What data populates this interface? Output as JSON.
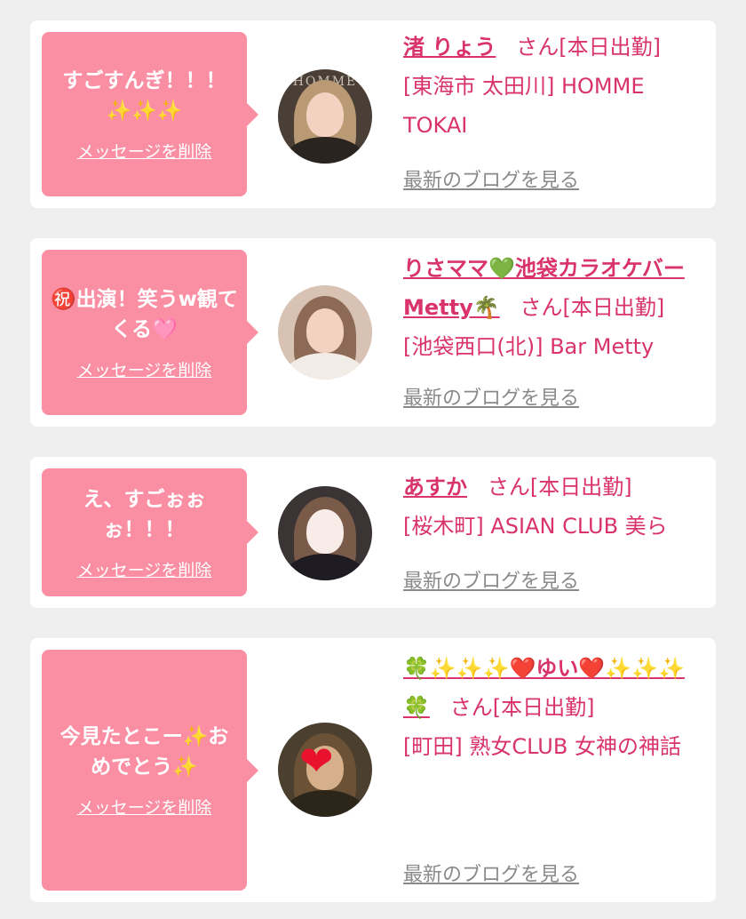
{
  "messages": [
    {
      "bubble_text": "すごすんぎ！！！✨✨✨",
      "delete_label": "メッセージを削除",
      "cast_name": "渚 りょう",
      "san_status": "さん[本日出勤]",
      "shop": "[東海市 太田川] HOMME TOKAI",
      "blog_label": "最新のブログを見る",
      "avatar_text": "HOMME"
    },
    {
      "bubble_text": "㊗️出演！笑うw観てくる🩷",
      "delete_label": "メッセージを削除",
      "cast_name": "りさママ💚池袋カラオケバーMetty🌴",
      "san_status": "さん[本日出勤]",
      "shop": "[池袋西口(北)] Bar Metty",
      "blog_label": "最新のブログを見る"
    },
    {
      "bubble_text": "え、すごぉぉぉ！！！",
      "delete_label": "メッセージを削除",
      "cast_name": "あすか",
      "san_status": "さん[本日出勤]",
      "shop": "[桜木町] ASIAN CLUB 美ら",
      "blog_label": "最新のブログを見る"
    },
    {
      "bubble_text": "今見たとこー✨おめでとう✨",
      "delete_label": "メッセージを削除",
      "cast_name": "🍀✨✨✨❤️ゆい❤️✨✨✨🍀",
      "san_status": "さん[本日出勤]",
      "shop": "[町田] 熟女CLUB 女神の神話",
      "blog_label": "最新のブログを見る",
      "avatar_overlay": "❤"
    }
  ],
  "colors": {
    "page_bg": "#f0eff0",
    "card_bg": "#ffffff",
    "bubble_bg": "#fa8fa3",
    "accent_text": "#d9336b",
    "blog_link": "#8a8a8a"
  }
}
